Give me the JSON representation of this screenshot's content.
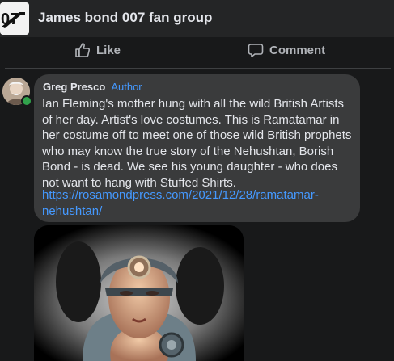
{
  "group": {
    "title": "James bond 007 fan group",
    "avatar_icon": "007-logo-icon"
  },
  "actions": {
    "like_label": "Like",
    "comment_label": "Comment"
  },
  "comment": {
    "author": "Greg Presco",
    "badge": "Author",
    "text": "Ian Fleming's mother hung with all the wild British Artists of her day. Artist's love costumes. This is Ramatamar in her costume off to meet one of those wild British prophets who may know the true story of the Nehushtan, Borish Bond - is dead. We see his young daughter - who does not want to hang with Stuffed Shirts.",
    "link": "https://rosamondpress.com/2021/12/28/ramatamar-nehushtan/"
  },
  "colors": {
    "background": "#18191a",
    "bubble": "#3a3b3c",
    "link": "#4599ff",
    "online": "#31a24c"
  }
}
